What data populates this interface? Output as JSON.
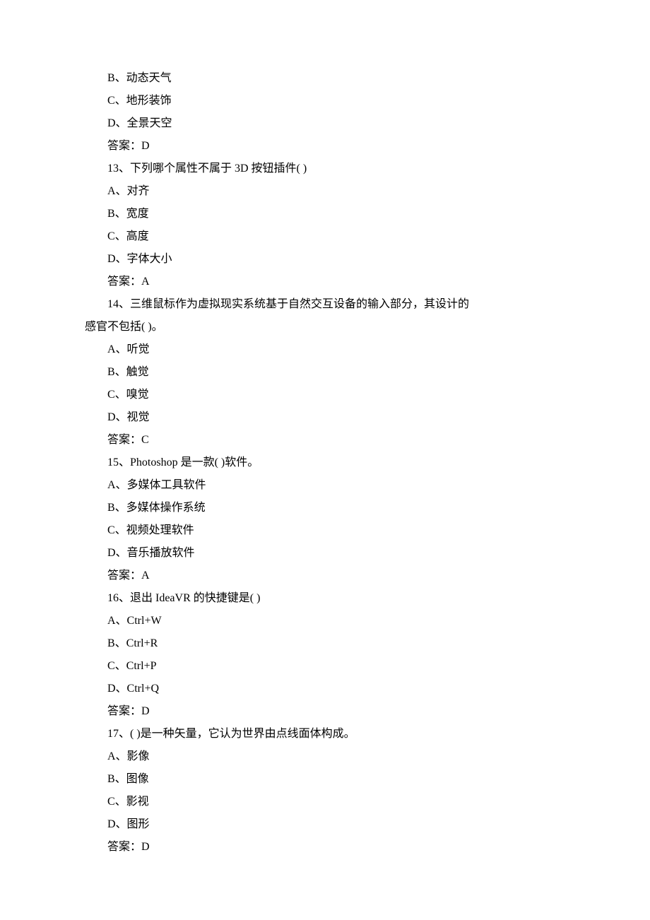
{
  "lines": [
    "B、动态天气",
    "C、地形装饰",
    "D、全景天空",
    "答案：D",
    "13、下列哪个属性不属于 3D 按钮插件( )",
    "A、对齐",
    "B、宽度",
    "C、高度",
    "D、字体大小",
    "答案：A",
    "14、三维鼠标作为虚拟现实系统基于自然交互设备的输入部分，其设计的",
    "感官不包括( )。",
    "A、听觉",
    "B、触觉",
    "C、嗅觉",
    "D、视觉",
    "答案：C",
    "15、Photoshop 是一款( )软件。",
    "A、多媒体工具软件",
    "B、多媒体操作系统",
    "C、视频处理软件",
    "D、音乐播放软件",
    "答案：A",
    "16、退出 IdeaVR 的快捷键是( )",
    "A、Ctrl+W",
    "B、Ctrl+R",
    "C、Ctrl+P",
    "D、Ctrl+Q",
    "答案：D",
    "17、( )是一种矢量，它认为世界由点线面体构成。",
    "A、影像",
    "B、图像",
    "C、影视",
    "D、图形",
    "答案：D"
  ],
  "noIndentIndices": [
    11
  ]
}
